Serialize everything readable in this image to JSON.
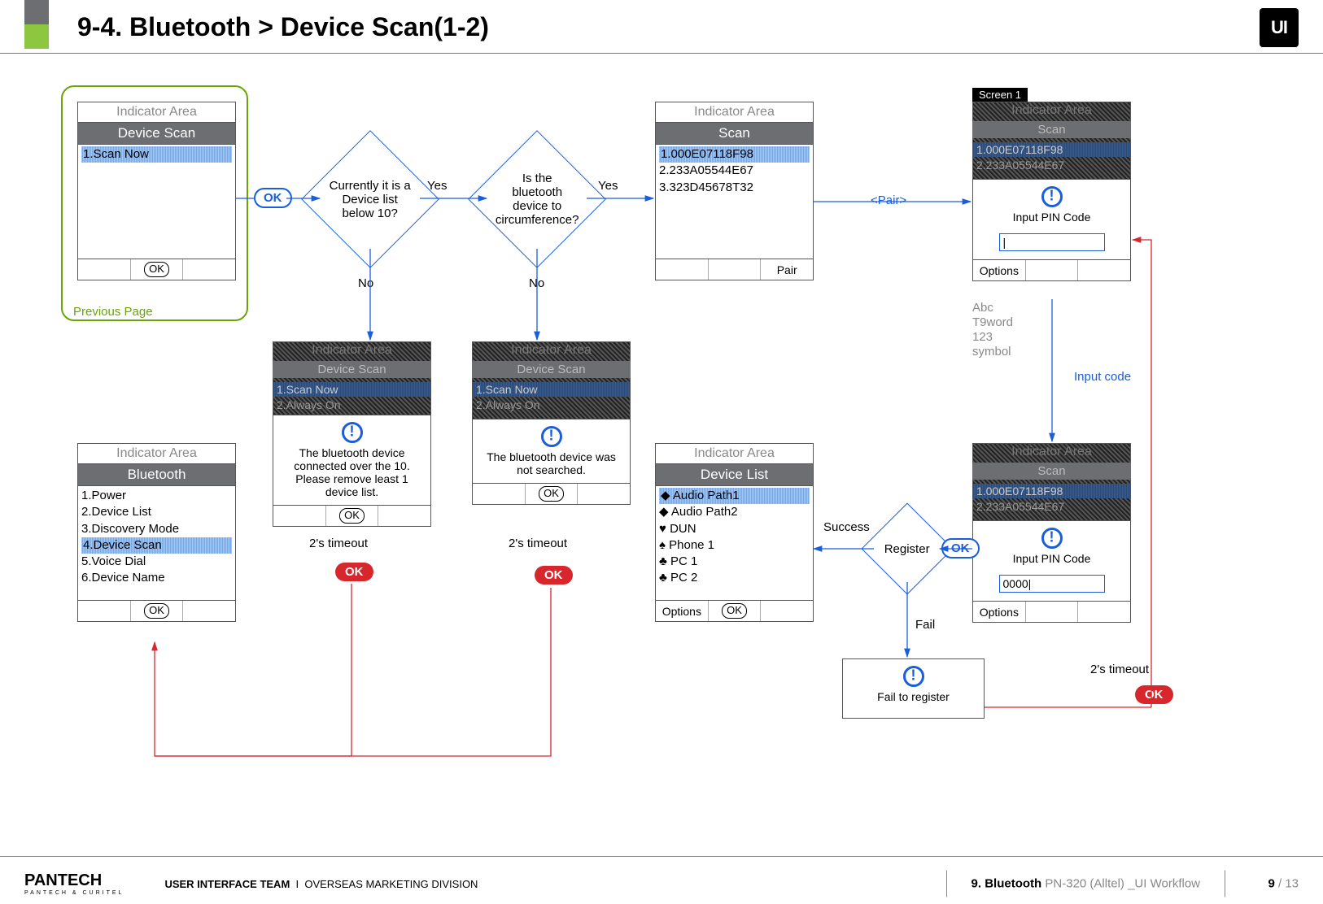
{
  "title": "9-4. Bluetooth > Device Scan(1-2)",
  "prevPage": "Previous Page",
  "indicator": "Indicator Area",
  "ok": "OK",
  "phones": {
    "deviceScan": {
      "title": "Device Scan",
      "sel": "1.Scan Now"
    },
    "scan": {
      "title": "Scan",
      "sel": "1.000E07118F98",
      "r2": "2.233A05544E67",
      "r3": "3.323D45678T32",
      "pair": "Pair"
    },
    "bluetooth": {
      "title": "Bluetooth",
      "r1": "1.Power",
      "r2": "2.Device List",
      "r3": "3.Discovery Mode",
      "sel": "4.Device Scan",
      "r5": "5.Voice Dial",
      "r6": "6.Device Name"
    },
    "deviceList": {
      "title": "Device List",
      "sel": "◆ Audio Path1",
      "r2": "◆ Audio Path2",
      "r3": "♥ DUN",
      "r4": "♠ Phone 1",
      "r5": "♣ PC 1",
      "r6": "♣ PC 2",
      "opt": "Options"
    }
  },
  "dims": {
    "ds": {
      "title": "Device Scan",
      "sel": "1.Scan Now",
      "r2": "2.Always On"
    },
    "scan": {
      "title": "Scan",
      "sel": "1.000E07118F98",
      "r2": "2.233A05544E67"
    }
  },
  "popups": {
    "over10": "The bluetooth device connected over the 10. Please remove least 1 device list.",
    "notFound": "The bluetooth device was not searched.",
    "pin": "Input PIN Code",
    "pinVal": "0000|",
    "options": "Options",
    "failReg": "Fail to register"
  },
  "diamonds": {
    "d1": "Currently it is a Device list below 10?",
    "d2": "Is the bluetooth device to circumference?",
    "reg": "Register"
  },
  "labels": {
    "yes": "Yes",
    "no": "No",
    "pairAction": "<Pair>",
    "inputCode": "Input code",
    "timeout": "2's timeout",
    "success": "Success",
    "fail": "Fail",
    "inputModes": {
      "a": "Abc",
      "b": "T9word",
      "c": "123",
      "d": "symbol"
    },
    "screen1": "Screen 1"
  },
  "footer": {
    "brand": "PANTECH",
    "brandSub": "PANTECH & CURITEL",
    "team": "USER INTERFACE TEAM",
    "div": "OVERSEAS MARKETING DIVISION",
    "section": "9. Bluetooth",
    "model": "PN-320 (Alltel) _UI Workflow",
    "page": "9",
    "total": "13"
  }
}
